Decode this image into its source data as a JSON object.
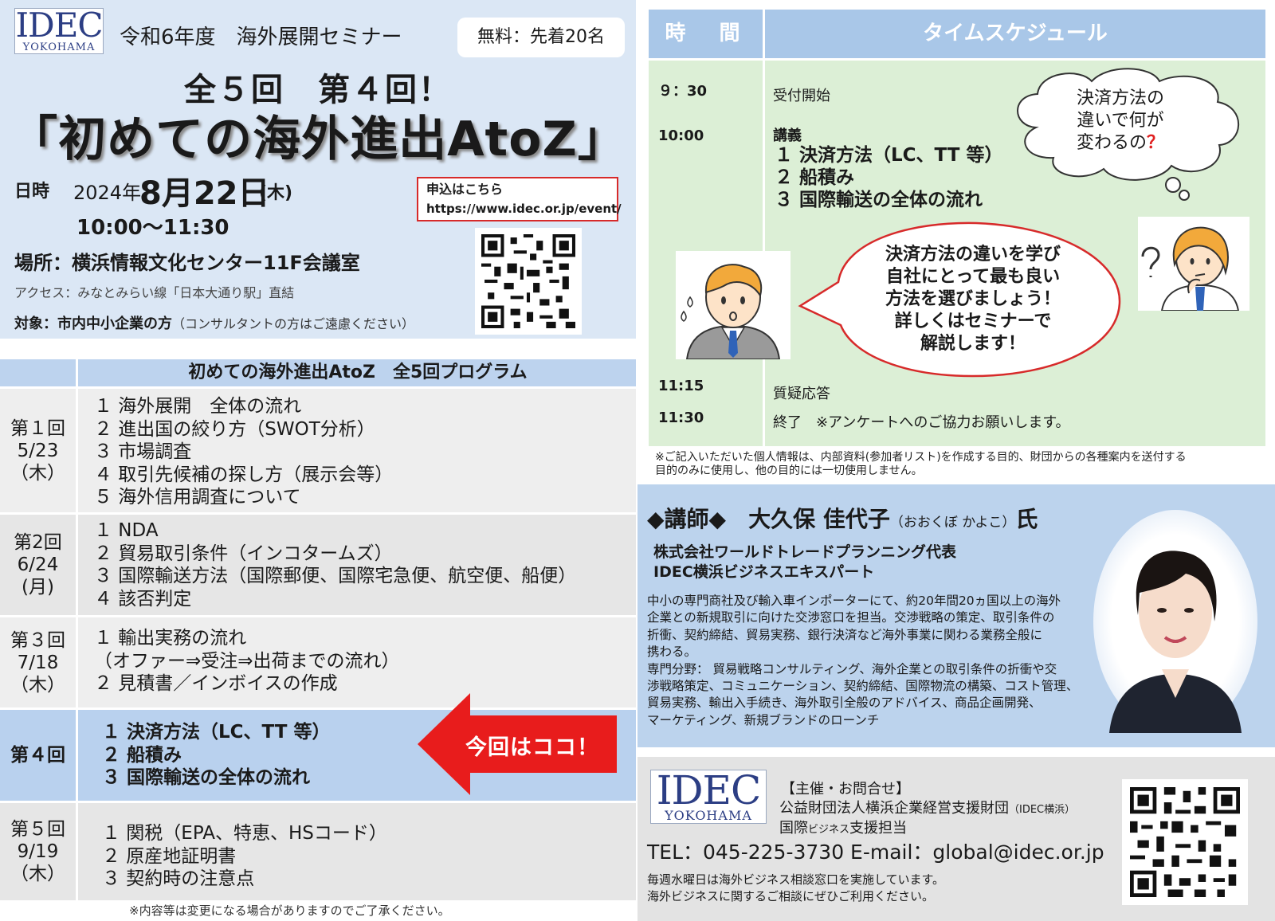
{
  "header": {
    "logo_big": "IDEC",
    "logo_small": "YOKOHAMA",
    "seminar_title": "令和6年度　海外展開セミナー",
    "free_badge": "無料：先着20名",
    "series_line": "全５回　第４回！",
    "main_title": "「初めての海外進出AtoZ」",
    "date_label": "日時",
    "date_year": "2024年",
    "date_md": "8月22日",
    "date_dow": "(木)",
    "date_time": "10:00～11:30",
    "apply_label": "申込はこちら",
    "apply_url": "https://www.idec.or.jp/event/",
    "venue": "場所：横浜情報文化センター11F会議室",
    "access": "アクセス：みなとみらい線「日本大通り駅」直結",
    "target_strong": "対象：市内中小企業の方",
    "target_note": "（コンサルタントの方はご遠慮ください）"
  },
  "program": {
    "title": "初めての海外進出AtoZ　全5回プログラム",
    "rows": [
      {
        "date_lines": [
          "第１回",
          "5/23",
          "（木）"
        ],
        "items": [
          "１ 海外展開　全体の流れ",
          "２ 進出国の絞り方（SWOT分析）",
          "３ 市場調査",
          "４ 取引先候補の探し方（展示会等）",
          "５ 海外信用調査について"
        ]
      },
      {
        "date_lines": [
          "第2回",
          "6/24",
          "(月)"
        ],
        "items": [
          "１ NDA",
          "２ 貿易取引条件（インコタームズ）",
          "３ 国際輸送方法（国際郵便、国際宅急便、航空便、船便）",
          "４ 該否判定"
        ]
      },
      {
        "date_lines": [
          "第３回",
          "7/18",
          "（木）"
        ],
        "items": [
          "１ 輸出実務の流れ",
          "（オファー⇒受注⇒出荷までの流れ）",
          "２ 見積書／インボイスの作成"
        ]
      },
      {
        "date_lines": [
          "第４回"
        ],
        "items": [
          "１ 決済方法（LC、TT 等）",
          "２ 船積み",
          "３ 国際輸送の全体の流れ"
        ]
      },
      {
        "date_lines": [
          "第５回",
          "9/19",
          "（木）"
        ],
        "items": [
          "１ 関税（EPA、特恵、HSコード）",
          "２ 原産地証明書",
          "３ 契約時の注意点"
        ]
      }
    ],
    "arrow_text": "今回はココ！",
    "footnote": "※内容等は変更になる場合がありますのでご了承ください。"
  },
  "schedule": {
    "col_time": "時　間",
    "col_sched": "タイムスケジュール",
    "t0930": "９：30",
    "reception": "受付開始",
    "t1000": "10:00",
    "lecture": "講義",
    "lecture_items": [
      "１ 決済方法（LC、TT 等）",
      "２ 船積み",
      "３ 国際輸送の全体の流れ"
    ],
    "t1115": "11:15",
    "qa": "質疑応答",
    "t1130": "11:30",
    "end": "終了　※アンケートへのご協力お願いします。",
    "cloud_lines": [
      "決済方法の",
      "違いで何が",
      "変わるの"
    ],
    "cloud_q": "？",
    "speech_lines": [
      "決済方法の違いを学び",
      "自社にとって最も良い",
      "方法を選びましょう！",
      "詳しくはセミナーで",
      "解説します！"
    ],
    "privacy_lines": [
      "※ご記入いただいた個人情報は、内部資料(参加者リスト)を作成する目的、財団からの各種案内を送付する",
      "目的のみに使用し、他の目的には一切使用しません。"
    ]
  },
  "instructor": {
    "title": "◆講師◆　大久保 佳代子",
    "ruby": "（おおくぼ かよこ）",
    "suffix": "氏",
    "aff1": "株式会社ワールドトレードプランニング代表",
    "aff2": "IDEC横浜ビジネスエキスパート",
    "bio_lines": [
      "中小の専門商社及び輸入車インポーターにて、約20年間20ヵ国以上の海外",
      "企業との新規取引に向けた交渉窓口を担当。交渉戦略の策定、取引条件の",
      "折衝、契約締結、貿易実務、銀行決済など海外事業に関わる業務全般に",
      "携わる。",
      "専門分野：  貿易戦略コンサルティング、海外企業との取引条件の折衝や交",
      "渉戦略策定、コミュニケーション、契約締結、国際物流の構築、コスト管理、",
      "貿易実務、輸出入手続き、海外取引全般のアドバイス、商品企画開発、",
      "マーケティング、新規ブランドのローンチ"
    ]
  },
  "contact": {
    "label": "【主催・お問合せ】",
    "org": "公益財団法人横浜企業経営支援財団",
    "org_abbr": "（IDEC横浜）",
    "dept_a": "国際",
    "dept_b": "ビジネス",
    "dept_c": "支援担当",
    "tel": "TEL：045-225-3730  E-mail：global@idec.or.jp",
    "info1": "毎週水曜日は海外ビジネス相談窓口を実施しています。",
    "info2": "海外ビジネスに関するご相談にぜひご利用ください。"
  },
  "colors": {
    "accent_blue": "#bdd3ee",
    "schedule_green": "#dcefd6",
    "arrow_red": "#e81c1c"
  }
}
